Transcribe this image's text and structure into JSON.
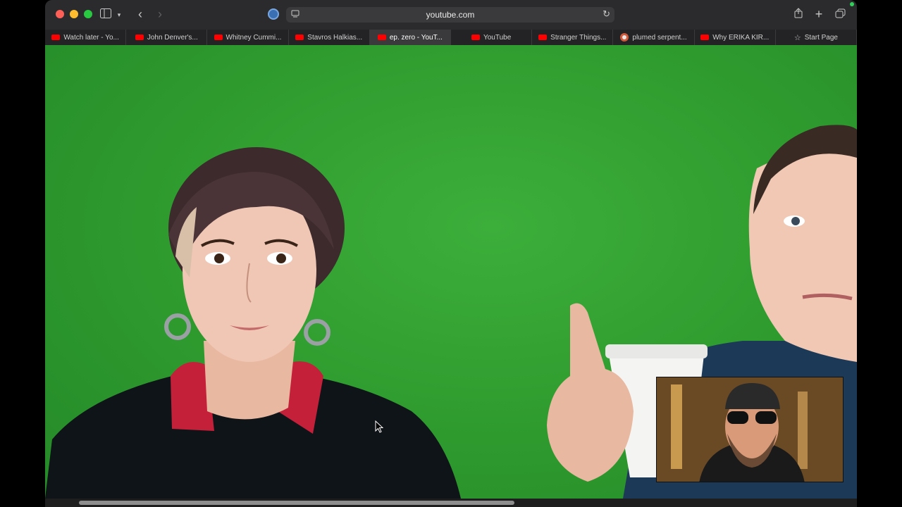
{
  "browser": {
    "address": "youtube.com",
    "tabs": [
      {
        "label": "Watch later - Yo...",
        "favicon": "youtube-icon",
        "active": false
      },
      {
        "label": "John Denver's...",
        "favicon": "youtube-icon",
        "active": false
      },
      {
        "label": "Whitney Cummi...",
        "favicon": "youtube-icon",
        "active": false
      },
      {
        "label": "Stavros Halkias...",
        "favicon": "youtube-icon",
        "active": false
      },
      {
        "label": "ep. zero - YouT...",
        "favicon": "youtube-icon",
        "active": true
      },
      {
        "label": "YouTube",
        "favicon": "youtube-icon",
        "active": false
      },
      {
        "label": "Stranger Things...",
        "favicon": "youtube-icon",
        "active": false
      },
      {
        "label": "plumed serpent...",
        "favicon": "duckduckgo-icon",
        "active": false
      },
      {
        "label": "Why ERIKA KIR...",
        "favicon": "youtube-icon",
        "active": false
      },
      {
        "label": "Start Page",
        "favicon": "star-icon",
        "active": false
      }
    ]
  },
  "colors": {
    "greenscreen": "#2e9a2e",
    "youtube_red": "#ff0000"
  }
}
